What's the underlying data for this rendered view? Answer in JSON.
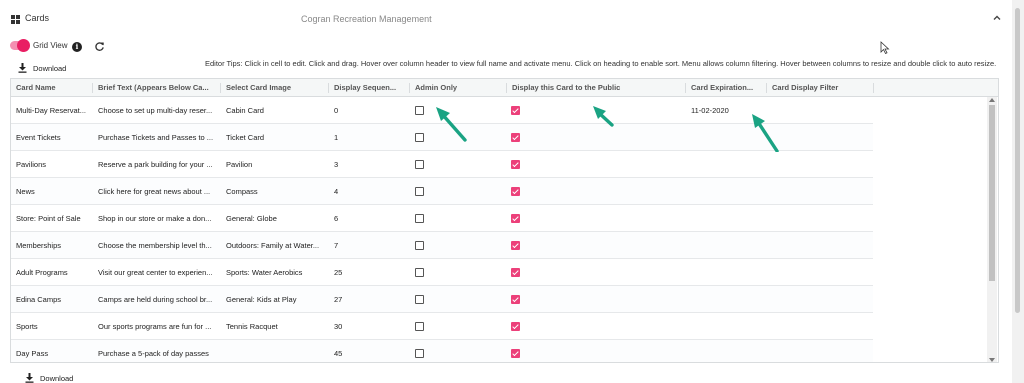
{
  "header": {
    "title": "Cards",
    "app_name": "Cogran Recreation Management"
  },
  "toolbar": {
    "grid_view_label": "Grid View",
    "grid_view_on": true,
    "download_label": "Download",
    "editor_tips": "Editor Tips: Click in cell to edit. Click and drag. Hover over column header to view full name and activate menu. Click on heading to enable sort. Menu allows column filtering. Hover between columns to resize and double click to auto resize."
  },
  "grid": {
    "columns": [
      "Card Name",
      "Brief Text (Appears Below Ca...",
      "Select Card Image",
      "Display Sequen...",
      "Admin Only",
      "Display this Card to the Public",
      "Card Expiration...",
      "Card Display Filter"
    ],
    "rows": [
      {
        "name": "Multi-Day Reservat...",
        "brief": "Choose to set up multi-day reser...",
        "image": "Cabin Card",
        "seq": "0",
        "admin": false,
        "public": true,
        "expiration": "11-02-2020",
        "filter": ""
      },
      {
        "name": "Event Tickets",
        "brief": "Purchase Tickets and Passes to ...",
        "image": "Ticket Card",
        "seq": "1",
        "admin": false,
        "public": true,
        "expiration": "",
        "filter": ""
      },
      {
        "name": "Pavilions",
        "brief": "Reserve a park building for your ...",
        "image": "Pavilion",
        "seq": "3",
        "admin": false,
        "public": true,
        "expiration": "",
        "filter": ""
      },
      {
        "name": "News",
        "brief": "Click here for great news about ...",
        "image": "Compass",
        "seq": "4",
        "admin": false,
        "public": true,
        "expiration": "",
        "filter": ""
      },
      {
        "name": "Store: Point of Sale",
        "brief": "Shop in our store or make a don...",
        "image": "General: Globe",
        "seq": "6",
        "admin": false,
        "public": true,
        "expiration": "",
        "filter": ""
      },
      {
        "name": "Memberships",
        "brief": "Choose the membership level th...",
        "image": "Outdoors: Family at Water...",
        "seq": "7",
        "admin": false,
        "public": true,
        "expiration": "",
        "filter": ""
      },
      {
        "name": "Adult Programs",
        "brief": "Visit our great center to experien...",
        "image": "Sports: Water Aerobics",
        "seq": "25",
        "admin": false,
        "public": true,
        "expiration": "",
        "filter": ""
      },
      {
        "name": "Edina Camps",
        "brief": "Camps are held during school br...",
        "image": "General: Kids at Play",
        "seq": "27",
        "admin": false,
        "public": true,
        "expiration": "",
        "filter": ""
      },
      {
        "name": "Sports",
        "brief": "Our sports programs are fun for ...",
        "image": "Tennis Racquet",
        "seq": "30",
        "admin": false,
        "public": true,
        "expiration": "",
        "filter": ""
      },
      {
        "name": "Day Pass",
        "brief": "Purchase a 5-pack of day passes",
        "image": "",
        "seq": "45",
        "admin": false,
        "public": true,
        "expiration": "",
        "filter": ""
      }
    ]
  },
  "colors": {
    "accent": "#e91e63",
    "checkbox_on": "#ec407a",
    "annotation_arrow": "#1aa383"
  },
  "icons": {
    "header": "grid-view-icon",
    "info": "info-icon",
    "refresh": "refresh-icon",
    "download": "download-icon",
    "collapse": "chevron-up-icon"
  }
}
